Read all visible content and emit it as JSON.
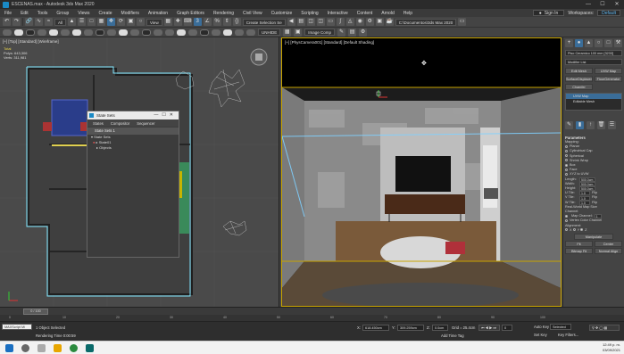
{
  "window": {
    "title": "ESCENAS.max - Autodesk 3ds Max 2020",
    "buttons": [
      "—",
      "☐",
      "✕"
    ]
  },
  "menu": {
    "items": [
      "File",
      "Edit",
      "Tools",
      "Group",
      "Views",
      "Create",
      "Modifiers",
      "Animation",
      "Graph Editors",
      "Rendering",
      "Civil View",
      "Customize",
      "Scripting",
      "Interactive",
      "Content",
      "Arnold",
      "Help"
    ],
    "signin": "Sign In",
    "workspaces_label": "Workspaces:",
    "workspaces_value": "Default"
  },
  "toolbar": {
    "filter": "All",
    "view_dropdown": "View",
    "selection_set": "Create Selection Se",
    "path": "C:\\Documentos\\3ds Max 2020",
    "unwrap_label": "UVW Unwrap",
    "image_comp": "Image Comp",
    "unhide": "UNHIDE"
  },
  "left_viewport": {
    "label": "[+] [Top] [Standard] [Wireframe]",
    "stats_total": "Total",
    "stats_polys": "Polys:  643,306",
    "stats_verts": "Verts:  311,981"
  },
  "right_viewport": {
    "label": "[+] [PhysCamera001] [Standard] [Default Shading]"
  },
  "dialog": {
    "title": "State Sets",
    "menu": [
      "States",
      "Compositor",
      "Sequencer"
    ],
    "header": "State Sets 1",
    "rows": [
      "State Sets",
      "State01",
      "Objects"
    ]
  },
  "command_panel": {
    "object_name": "Piso Ceramico 100 mm [3233]",
    "modifier_list": "Modifier List",
    "buttons": [
      "Edit Mesh",
      "UVW Map",
      "SurfaceDisplacement",
      "FloorGenerator",
      "Chamfer"
    ],
    "stack": [
      "UVW Map",
      "Editable Mesh"
    ],
    "parameters_title": "Parameters",
    "mapping_label": "Mapping:",
    "mapping_options": [
      "Planar",
      "Cylindrical",
      "Cap",
      "Spherical",
      "Shrink Wrap",
      "Box",
      "Face",
      "XYZ to UVW"
    ],
    "mapping_selected": "Box",
    "length_label": "Length:",
    "length_value": "500.0cm",
    "width_label": "Width:",
    "width_value": "500.0cm",
    "height_label": "Height:",
    "height_value": "500.0cm",
    "utile_label": "U Tile:",
    "utile_value": "1.0",
    "vtile_label": "V Tile:",
    "vtile_value": "1.0",
    "wtile_label": "W Tile:",
    "wtile_value": "1.0",
    "flip_label": "Flip",
    "real_world": "Real-World Map Size",
    "channel_label": "Channel:",
    "map_channel": "Map Channel:",
    "map_channel_value": "1",
    "vertex_color": "Vertex Color Channel",
    "alignment_label": "Alignment:",
    "axes": [
      "X",
      "Y",
      "Z"
    ],
    "manipulate": "Manipulate",
    "fit": "Fit",
    "center": "Center",
    "bitmap_fit": "Bitmap Fit",
    "normal_align": "Normal Align"
  },
  "timeline": {
    "slider": "0 / 100",
    "ticks": [
      "0",
      "10",
      "20",
      "30",
      "40",
      "50",
      "60",
      "70",
      "80",
      "90",
      "100"
    ]
  },
  "status": {
    "maxscript": "MAXScript Mi",
    "selected": "1 Object Selected",
    "rendering_time": "Rendering Time  0:00:59",
    "x_label": "X:",
    "x_value": "618.450cm",
    "y_label": "Y:",
    "y_value": "309.259cm",
    "z_label": "Z:",
    "z_value": "0.0cm",
    "grid": "Grid = 25.4cm",
    "add_time_tag": "Add Time Tag",
    "auto_key": "Auto Key",
    "set_key": "Set Key",
    "selected_dd": "Selected",
    "key_filters": "Key Filters...",
    "frame": "0"
  },
  "taskbar": {
    "time": "12:49 p. m.",
    "date": "03/09/2021"
  }
}
